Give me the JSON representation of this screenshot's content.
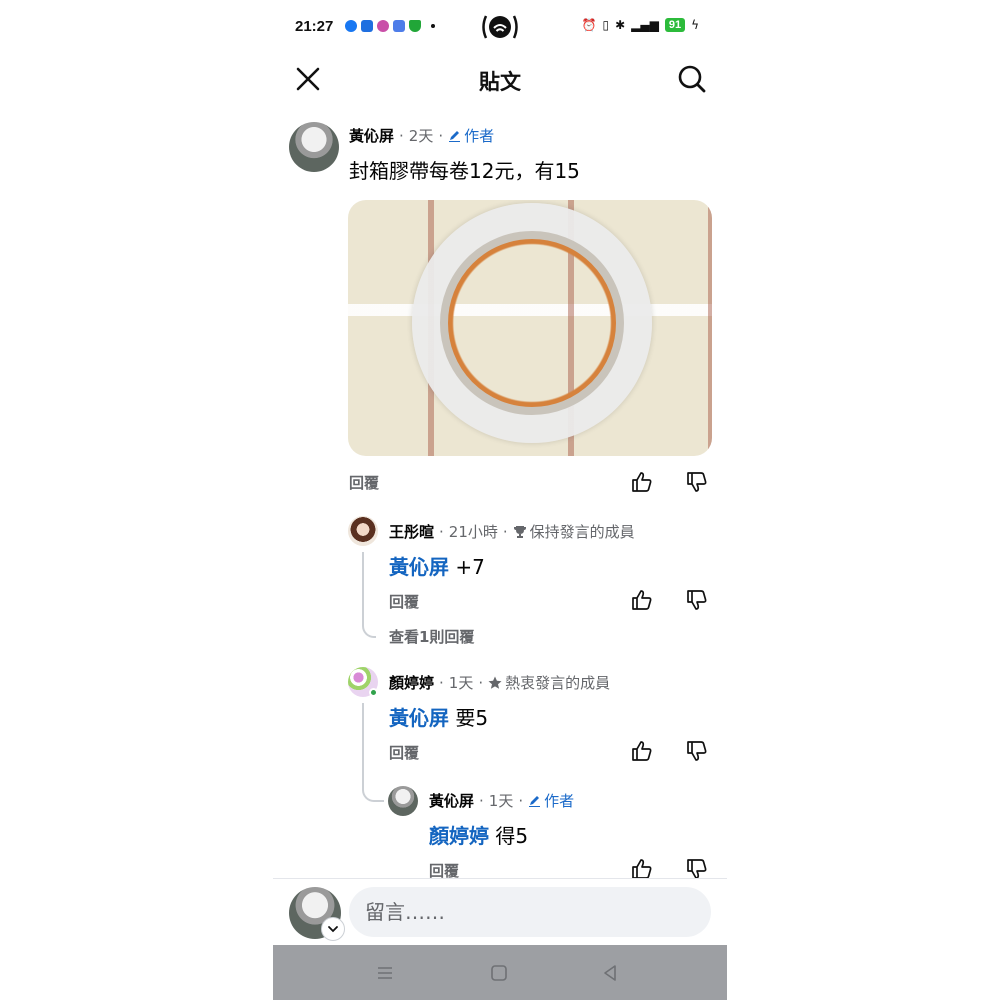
{
  "status_bar": {
    "time": "21:27",
    "battery": "91",
    "app_icons": [
      {
        "icon": "messenger-icon",
        "color": "#1877f2"
      },
      {
        "icon": "cloud-app-icon",
        "color": "#1f6fe0"
      },
      {
        "icon": "flower-app-icon",
        "color": "#c94fa8"
      },
      {
        "icon": "photo-app-icon",
        "color": "#4e7de9"
      },
      {
        "icon": "shield-app-icon",
        "color": "#21a638"
      }
    ]
  },
  "header": {
    "title": "貼文"
  },
  "colors": {
    "accent": "#1465c0",
    "secondary_text": "#65676b",
    "primary_text": "#050505",
    "input_bg": "#f0f2f5",
    "nav_bg": "#9d9fa3"
  },
  "post": {
    "author": "黃伈屏",
    "time": "2天",
    "badge": "作者",
    "text": "封箱膠帶每卷12元，有15",
    "reply_label": "回覆"
  },
  "comments": [
    {
      "author": "王彤暄",
      "time": "21小時",
      "badge": "保持發言的成員",
      "mention": "黃伈屏",
      "text": " +7",
      "reply_label": "回覆",
      "view_replies": "查看1則回覆"
    },
    {
      "author": "顏婷婷",
      "time": "1天",
      "badge": "熱衷發言的成員",
      "mention": "黃伈屏",
      "text": " 要5",
      "reply_label": "回覆"
    }
  ],
  "nested_reply": {
    "author": "黃伈屏",
    "time": "1天",
    "badge": "作者",
    "mention": "顏婷婷",
    "text": " 得5",
    "reply_label": "回覆"
  },
  "composer": {
    "placeholder": "留言……"
  }
}
